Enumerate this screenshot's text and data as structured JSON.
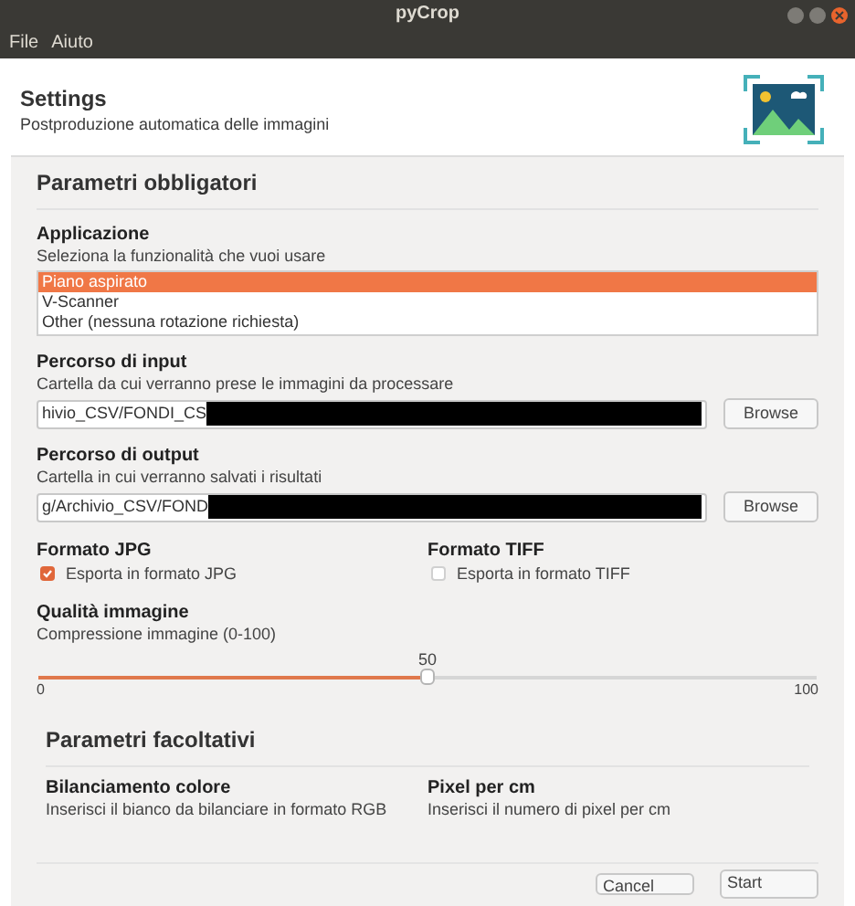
{
  "window": {
    "title": "pyCrop"
  },
  "menu": [
    "File",
    "Aiuto"
  ],
  "header": {
    "title": "Settings",
    "subtitle": "Postproduzione automatica delle immagini"
  },
  "required_section": {
    "title": "Parametri obbligatori",
    "application": {
      "label": "Applicazione",
      "hint": "Seleziona la funzionalità che vuoi usare",
      "options": [
        {
          "label": "Piano aspirato",
          "selected": true
        },
        {
          "label": "V-Scanner",
          "selected": false
        },
        {
          "label": "Other (nessuna rotazione richiesta)",
          "selected": false
        }
      ]
    },
    "paths": [
      {
        "label": "Percorso di input",
        "hint": "Cartella da cui verranno prese le immagini da processare",
        "value": "hivio_CSV/FONDI_CS",
        "redacted": true,
        "button": "Browse"
      },
      {
        "label": "Percorso di output",
        "hint": "Cartella in cui verranno salvati i risultati",
        "value": "g/Archivio_CSV/FOND",
        "redacted": true,
        "button": "Browse"
      }
    ],
    "formats": [
      {
        "label": "Formato JPG",
        "option": "Esporta in formato JPG",
        "checked": true
      },
      {
        "label": "Formato TIFF",
        "option": "Esporta in formato TIFF",
        "checked": false
      }
    ],
    "quality": {
      "label": "Qualità immagine",
      "hint": "Compressione immagine (0-100)",
      "value": "50",
      "level": 0.5,
      "min": "0",
      "max": "100"
    }
  },
  "optional_section": {
    "title": "Parametri facoltativi",
    "fields": [
      {
        "label": "Bilanciamento colore",
        "hint": "Inserisci il bianco da bilanciare in formato RGB"
      },
      {
        "label": "Pixel per cm",
        "hint": "Inserisci il numero di pixel per cm"
      }
    ]
  },
  "buttons": [
    "Cancel",
    "Start"
  ]
}
